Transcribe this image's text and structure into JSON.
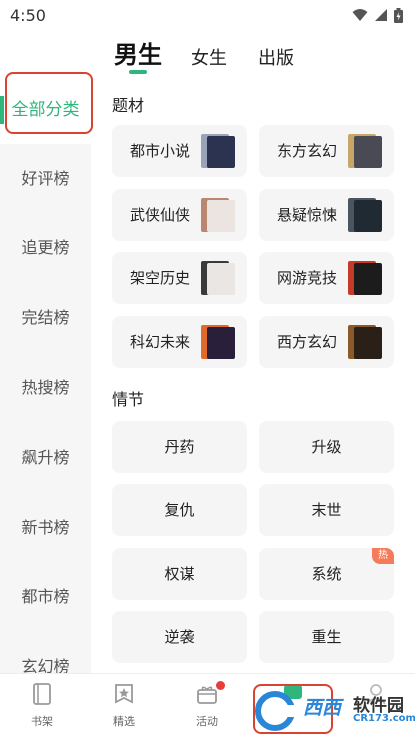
{
  "status_bar": {
    "time": "4:50"
  },
  "top_tabs": [
    {
      "label": "男生",
      "active": true
    },
    {
      "label": "女生",
      "active": false
    },
    {
      "label": "出版",
      "active": false
    }
  ],
  "sidebar": {
    "items": [
      {
        "label": "全部分类",
        "active": true
      },
      {
        "label": "好评榜"
      },
      {
        "label": "追更榜"
      },
      {
        "label": "完结榜"
      },
      {
        "label": "热搜榜"
      },
      {
        "label": "飙升榜"
      },
      {
        "label": "新书榜"
      },
      {
        "label": "都市榜"
      },
      {
        "label": "玄幻榜"
      }
    ]
  },
  "genre_section": {
    "title": "题材",
    "items": [
      {
        "label": "都市小说"
      },
      {
        "label": "东方玄幻"
      },
      {
        "label": "武侠仙侠"
      },
      {
        "label": "悬疑惊悚"
      },
      {
        "label": "架空历史"
      },
      {
        "label": "网游竞技"
      },
      {
        "label": "科幻未来"
      },
      {
        "label": "西方玄幻"
      }
    ]
  },
  "plot_section": {
    "title": "情节",
    "items": [
      {
        "label": "丹药"
      },
      {
        "label": "升级"
      },
      {
        "label": "复仇"
      },
      {
        "label": "末世"
      },
      {
        "label": "权谋"
      },
      {
        "label": "系统",
        "badge": "热"
      },
      {
        "label": "逆袭"
      },
      {
        "label": "重生"
      }
    ]
  },
  "bottom_nav": [
    {
      "label": "书架",
      "icon": "bookshelf-icon"
    },
    {
      "label": "精选",
      "icon": "featured-icon"
    },
    {
      "label": "活动",
      "icon": "gift-icon"
    },
    {
      "label": "",
      "icon": "category-icon"
    },
    {
      "label": "",
      "icon": "profile-icon"
    }
  ],
  "watermark": {
    "brand": "西西",
    "name": "软件园",
    "domain": "CR173.com"
  },
  "colors": {
    "accent": "#2fb67d",
    "highlight_box": "#d9432f",
    "hot_badge": "#f47c5b"
  }
}
